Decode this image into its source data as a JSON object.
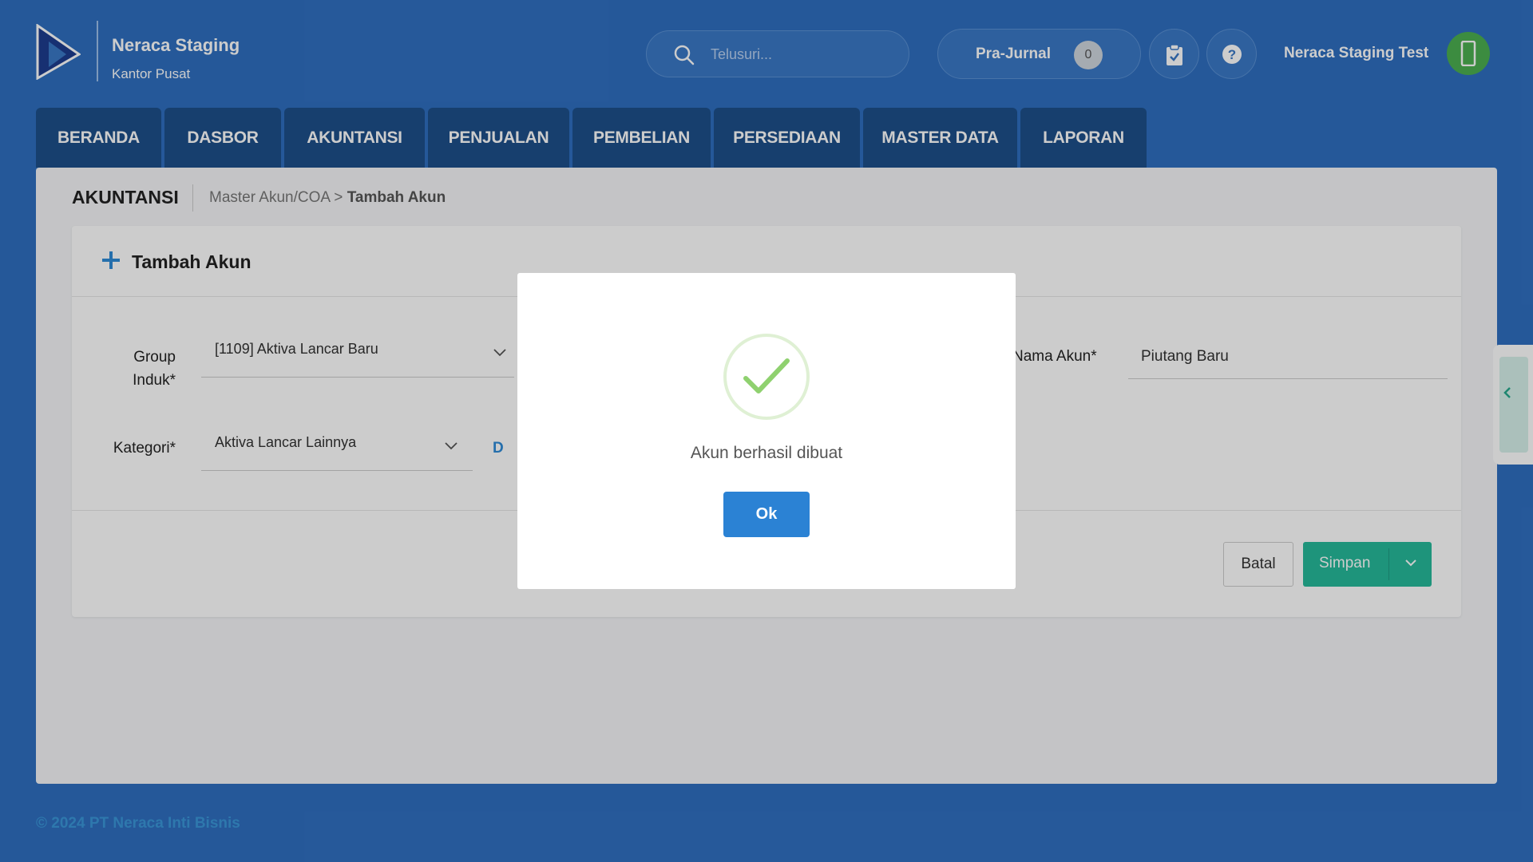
{
  "header": {
    "app_name": "Neraca Staging",
    "branch": "Kantor Pusat",
    "search_placeholder": "Telusuri...",
    "pra_jurnal_label": "Pra-Jurnal",
    "pra_jurnal_count": "0",
    "user_name": "Neraca Staging Test"
  },
  "nav": {
    "tabs": [
      "BERANDA",
      "DASBOR",
      "AKUNTANSI",
      "PENJUALAN",
      "PEMBELIAN",
      "PERSEDIAAN",
      "MASTER DATA",
      "LAPORAN"
    ]
  },
  "page": {
    "section": "AKUNTANSI",
    "breadcrumb_parent": "Master Akun/COA",
    "breadcrumb_sep": ">",
    "breadcrumb_current": "Tambah Akun"
  },
  "form": {
    "title": "Tambah Akun",
    "group_label_line1": "Group",
    "group_label_line2": "Induk*",
    "group_value": "[1109] Aktiva Lancar Baru",
    "kategori_label": "Kategori*",
    "kategori_value": "Aktiva Lancar Lainnya",
    "d_link": "D",
    "nama_label": "Nama Akun*",
    "nama_value": "Piutang Baru",
    "batal_label": "Batal",
    "simpan_label": "Simpan"
  },
  "modal": {
    "message": "Akun berhasil dibuat",
    "ok_label": "Ok"
  },
  "footer": {
    "copyright": "© 2024 PT Neraca Inti Bisnis"
  },
  "colors": {
    "background": "#2f6fc0",
    "nav_tab": "#1d4f8a",
    "primary_button": "#26b99a",
    "ok_button": "#2b82d4",
    "avatar": "#4caf50"
  }
}
